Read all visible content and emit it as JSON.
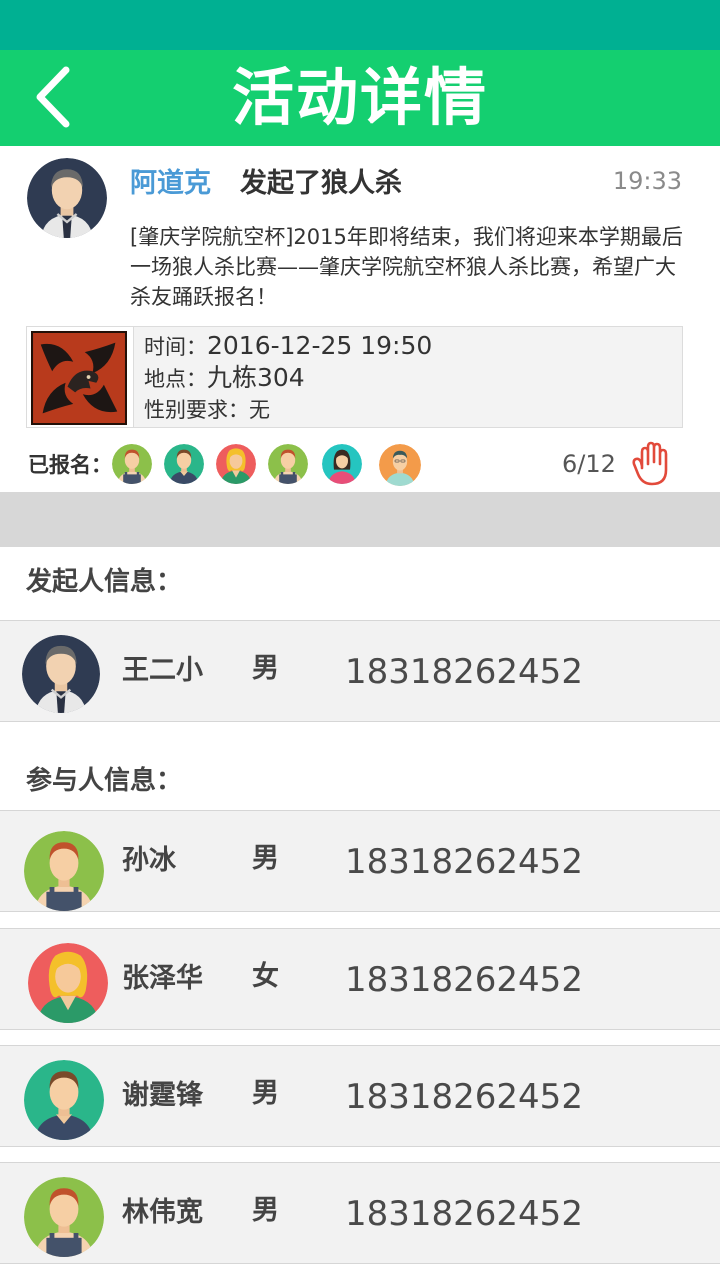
{
  "nav": {
    "title": "活动详情",
    "back_icon": "chevron-left-icon"
  },
  "post": {
    "author": "阿道克",
    "action": "发起了狼人杀",
    "time": "19:33",
    "description": "[肇庆学院航空杯]2015年即将结束，我们将迎来本学期最后一场狼人杀比赛——肇庆学院航空杯狼人杀比赛，希望广大杀友踊跃报名！"
  },
  "game": {
    "time_label": "时间：",
    "time_value": "2016-12-25 19:50",
    "place_label": "地点：",
    "place_value": "九栋304",
    "gender_label": "性别要求：",
    "gender_value": "无"
  },
  "signup": {
    "label": "已报名：",
    "count": "6/12",
    "hand_icon": "raise-hand-icon"
  },
  "organizer": {
    "section_title": "发起人信息：",
    "name": "王二小",
    "gender": "男",
    "phone": "18318262452"
  },
  "participants": {
    "section_title": "参与人信息：",
    "list": [
      {
        "name": "孙冰",
        "gender": "男",
        "phone": "18318262452"
      },
      {
        "name": "张泽华",
        "gender": "女",
        "phone": "18318262452"
      },
      {
        "name": "谢霆锋",
        "gender": "男",
        "phone": "18318262452"
      },
      {
        "name": "林伟宽",
        "gender": "男",
        "phone": "18318262452"
      }
    ]
  },
  "colors": {
    "status_bar": "#00b092",
    "nav_bar": "#14cf70",
    "author_blue": "#4a9ad6",
    "hand_red": "#e24a3b"
  }
}
